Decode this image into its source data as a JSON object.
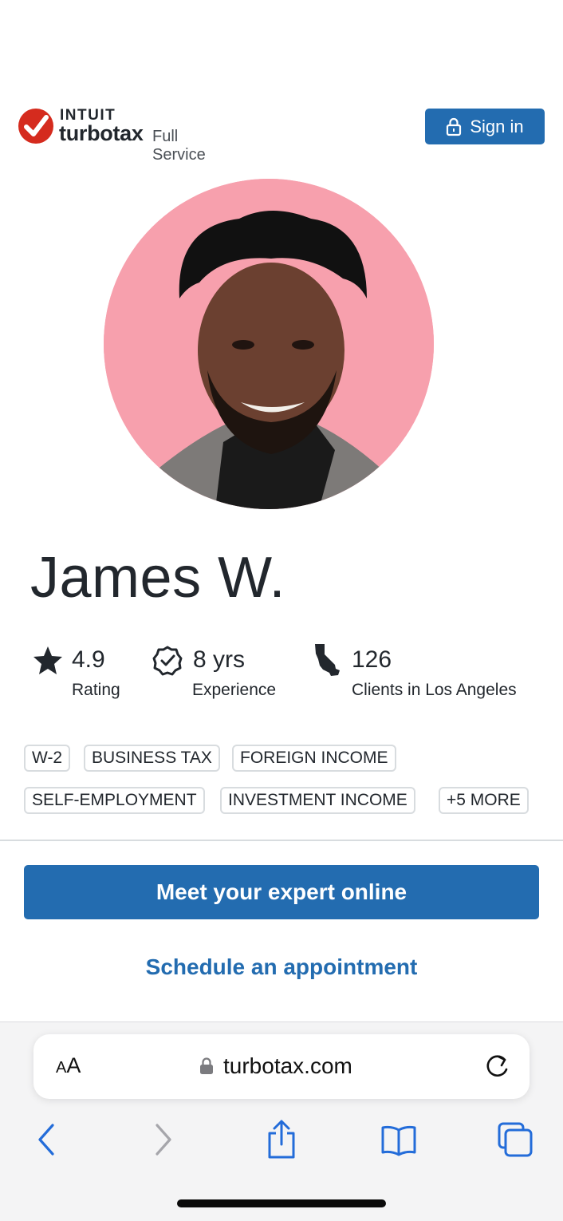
{
  "brand": {
    "intuit": "INTUIT",
    "turbotax": "turbotax",
    "tier": "Full Service",
    "check_color": "#d52b1e"
  },
  "header": {
    "signin_label": "Sign in",
    "signin_icon": "lock-icon"
  },
  "expert": {
    "name": "James W.",
    "avatar_bg": "#f7a0ad",
    "stats": [
      {
        "icon": "star-icon",
        "value": "4.9",
        "label": "Rating"
      },
      {
        "icon": "verified-badge-icon",
        "value": "8 yrs",
        "label": "Experience"
      },
      {
        "icon": "california-map-icon",
        "value": "126",
        "label": "Clients in Los Angeles"
      }
    ],
    "tags": [
      "W-2",
      "BUSINESS TAX",
      "FOREIGN INCOME",
      "SELF-EMPLOYMENT",
      "INVESTMENT INCOME",
      "+5 MORE"
    ]
  },
  "actions": {
    "primary": "Meet your expert online",
    "secondary": "Schedule an appointment"
  },
  "colors": {
    "accent": "#236cb0",
    "text": "#22272d",
    "border": "#d8dcdf"
  },
  "browser": {
    "text_size_label_small": "A",
    "text_size_label_large": "A",
    "url": "turbotax.com",
    "toolbar": [
      "back-icon",
      "forward-icon",
      "share-icon",
      "bookmarks-icon",
      "tabs-icon"
    ]
  }
}
